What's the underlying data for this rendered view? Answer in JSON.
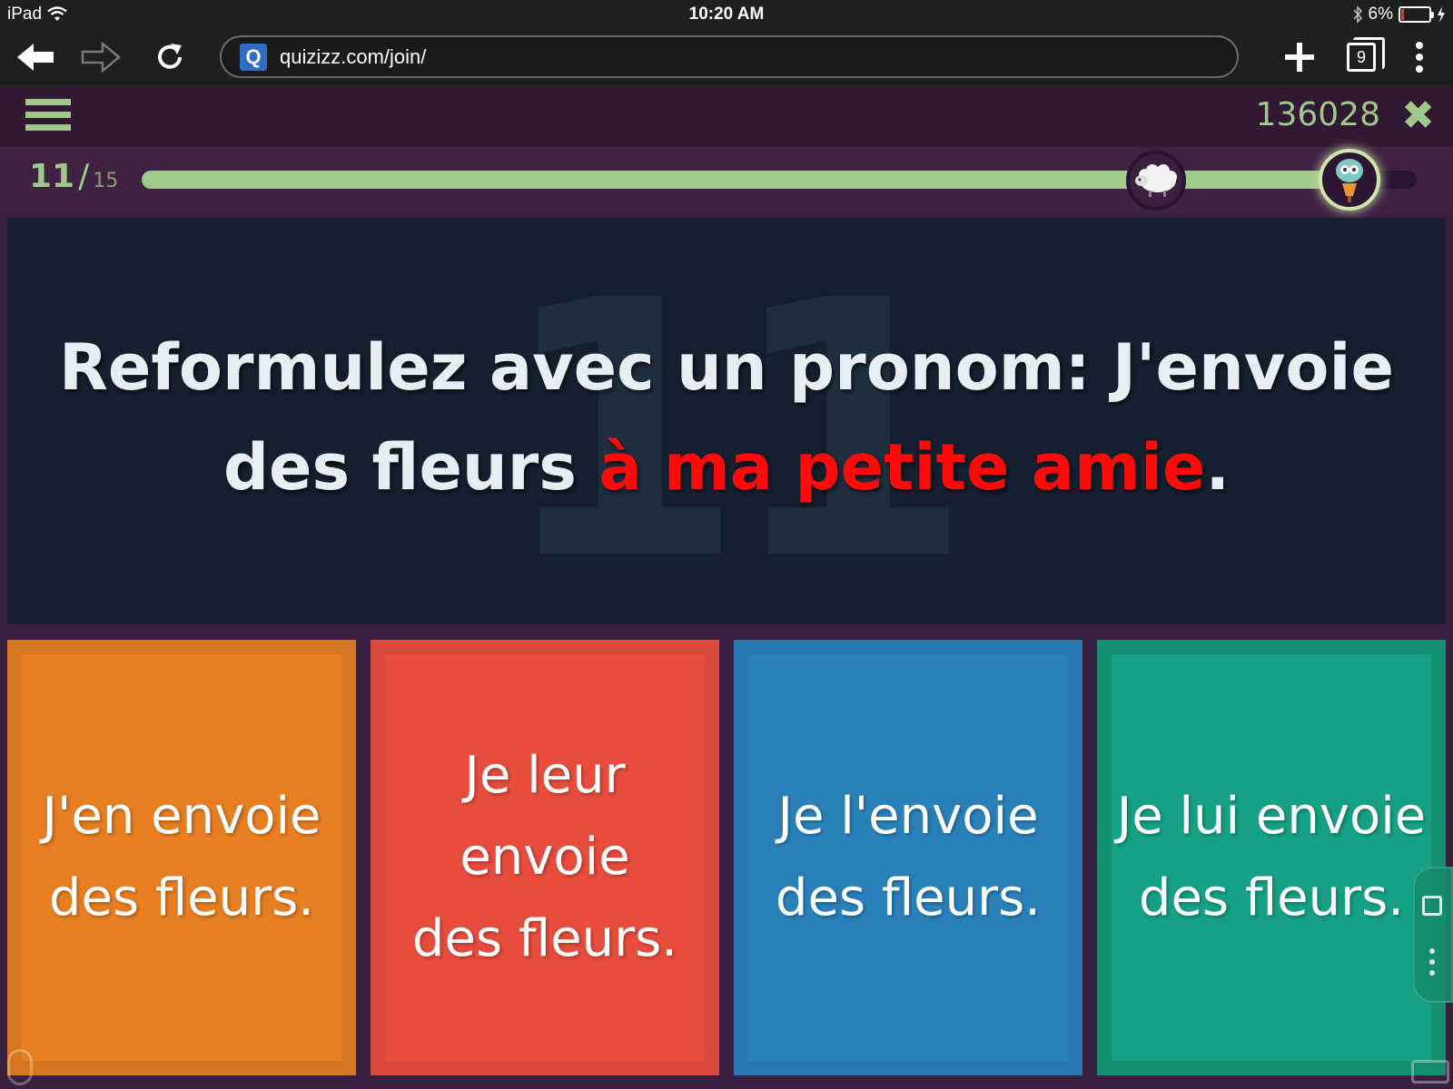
{
  "status_bar": {
    "device": "iPad",
    "time": "10:20 AM",
    "battery_percent": "6%",
    "battery_level": 0.06
  },
  "browser": {
    "url": "quizizz.com/join/",
    "favicon_letter": "Q",
    "tab_count": "9",
    "icons": [
      "back-arrow-icon",
      "forward-arrow-icon",
      "reload-icon",
      "new-tab-icon",
      "tabs-icon",
      "menu-dots-icon"
    ]
  },
  "quiz_header": {
    "game_code": "136028",
    "close_glyph": "✖"
  },
  "progress": {
    "current": "11",
    "separator": "/",
    "total": "15",
    "fill_fraction": 0.93
  },
  "question": {
    "number_watermark": "11",
    "text_before": "Reformulez avec un pronom: J'envoie des fleurs ",
    "text_highlight": "à ma petite amie",
    "text_after": ".",
    "highlight_color": "#ff0a0a"
  },
  "answers": [
    {
      "line1": "J'en envoie",
      "line2": "des fleurs.",
      "color": "#e67e22"
    },
    {
      "line1": "Je leur envoie",
      "line2": "des fleurs.",
      "color": "#e74c3c"
    },
    {
      "line1": "Je l'envoie",
      "line2": "des fleurs.",
      "color": "#2980b9"
    },
    {
      "line1": "Je lui envoie",
      "line2": "des fleurs.",
      "color": "#16a085"
    }
  ],
  "colors": {
    "accent_green": "#9fc98a",
    "header_bg": "#321832",
    "question_bg": "#14202f"
  }
}
